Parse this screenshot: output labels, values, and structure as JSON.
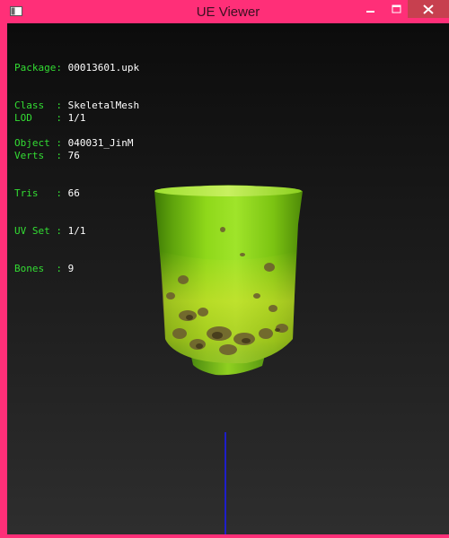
{
  "window": {
    "title": "UE Viewer"
  },
  "titlebar_buttons": {
    "minimize_icon": "minimize-icon",
    "maximize_icon": "maximize-icon",
    "close_icon": "close-icon"
  },
  "info": {
    "package": {
      "label": "Package:",
      "value": "00013601.upk"
    },
    "class": {
      "label": "Class  :",
      "value": "SkeletalMesh"
    },
    "object": {
      "label": "Object :",
      "value": "040031_JinM"
    },
    "lod": {
      "label": "LOD    :",
      "value": "1/1"
    },
    "verts": {
      "label": "Verts  :",
      "value": "76"
    },
    "tris": {
      "label": "Tris   :",
      "value": "66"
    },
    "uvset": {
      "label": "UV Set :",
      "value": "1/1"
    },
    "bones": {
      "label": "Bones  :",
      "value": "9"
    }
  },
  "colors": {
    "frame": "#ff2f78",
    "close_button": "#c7404f",
    "label_text": "#33dd33",
    "value_text": "#ffffff",
    "axis_line": "#1a1aff",
    "mesh_green": "#8fd81a"
  }
}
